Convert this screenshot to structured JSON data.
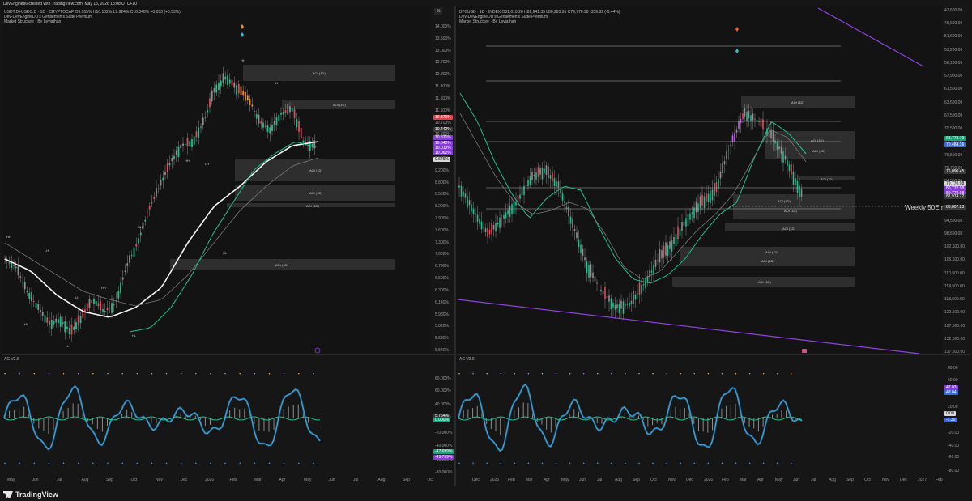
{
  "header": {
    "credit": "DevEngine86 created with TradingView.com, May 15, 2026 18:08 UTC+10"
  },
  "left_chart": {
    "symbol_line": "USDT.D+USDC.D · 1D · CRYPTOCAP  O9.955%  H10.102%  L9.924%  C10.040%  +0.053 (+0.53%)",
    "indicator_1": "Dev-DevEngineDU's Gentlemen's Suite Premium",
    "indicator_2": "Market Structure · By Leviathan",
    "pct_button": "%",
    "price_axis": [
      "14.000%",
      "13.500%",
      "13.000%",
      "12.700%",
      "12.300%",
      "11.900%",
      "11.500%",
      "11.100%",
      "10.700%",
      "10.300%",
      "9.900%",
      "9.500%",
      "9.200%",
      "8.800%",
      "8.500%",
      "8.200%",
      "7.900%",
      "7.600%",
      "7.300%",
      "7.000%",
      "6.790%",
      "6.500%",
      "6.300%",
      "6.140%",
      "5.980%",
      "5.820%",
      "5.680%",
      "5.540%"
    ],
    "badges": [
      {
        "text": "10.870%",
        "color": "#e0404a"
      },
      {
        "text": "10.442%",
        "color": "#3a3a3a"
      },
      {
        "text": "10.371%",
        "color": "#8a3be0"
      },
      {
        "text": "10.040%",
        "color": "#8a3be0"
      },
      {
        "text": "10.013%",
        "color": "#8a3be0"
      },
      {
        "text": "10.062%",
        "color": "#8a3be0"
      },
      {
        "text": "9.645%",
        "color": "#d8d8d8"
      }
    ],
    "time_axis": [
      "May",
      "Jun",
      "Jul",
      "Aug",
      "Sep",
      "Oct",
      "Nov",
      "Dec",
      "2026",
      "Feb",
      "Mar",
      "Apr",
      "May",
      "Jun",
      "Jul",
      "Aug",
      "Sep",
      "Oct"
    ],
    "structure_labels": [
      "HH",
      "LH",
      "HH",
      "LH",
      "HL",
      "LL",
      "HH",
      "HH",
      "LH",
      "HH",
      "LH",
      "HL",
      "HL"
    ],
    "aoi_label": "AOI (1D)",
    "osc_title": "AC V2.6",
    "osc_axis": [
      "80.000%",
      "60.000%",
      "40.000%",
      "20.000%",
      "-20.000%",
      "-40.000%",
      "-60.000%",
      "-80.000%"
    ],
    "osc_badges": [
      {
        "text": "5.764%",
        "color": "#3a3a3a"
      },
      {
        "text": "0.000%",
        "color": "#16a37a"
      },
      {
        "text": "-47.699%",
        "color": "#16a37a"
      },
      {
        "text": "-49.739%",
        "color": "#8a3be0"
      }
    ]
  },
  "right_chart": {
    "symbol_line": "BTCUSD · 1D · INDEX  O81,010.26  H81,641.35  L80,283.95  C79,770.98  -359.89 (-0.44%)",
    "indicator_1": "Dev-DevEngineDU's Gentlemen's Suite Premium",
    "indicator_2": "Market Structure · By Leviathan",
    "price_axis": [
      "47,600.00",
      "49,600.00",
      "51,600.00",
      "53,200.00",
      "56,100.00",
      "57,900.00",
      "61,500.00",
      "63,500.00",
      "67,500.00",
      "70,500.00",
      "73,500.00",
      "76,500.00",
      "79,700.00",
      "84,500.00",
      "87,000.00",
      "90,500.00",
      "94,500.00",
      "98,600.00",
      "102,500.00",
      "106,500.00",
      "110,500.00",
      "114,500.00",
      "118,500.00",
      "122,500.00",
      "127,500.00",
      "132,500.00",
      "137,600.00"
    ],
    "badges": [
      {
        "text": "68,773.79",
        "color": "#16a37a"
      },
      {
        "text": "70,484.16",
        "color": "#3a6ad8"
      },
      {
        "text": "76,090.45",
        "color": "#3a3a3a"
      },
      {
        "text": "79,770.98",
        "color": "#d8d8d8"
      },
      {
        "text": "80,772.98",
        "color": "#8a3be0"
      },
      {
        "text": "80,772.98",
        "color": "#8a3be0"
      },
      {
        "text": "81,974.72",
        "color": "#3a3a3a"
      },
      {
        "text": "85,807.23",
        "color": "#3a3a3a"
      }
    ],
    "weekly_ema": "Weekly 50Ema",
    "time_axis": [
      "Dec",
      "2025",
      "Feb",
      "Mar",
      "Apr",
      "May",
      "Jun",
      "Jul",
      "Aug",
      "Sep",
      "Oct",
      "Nov",
      "Dec",
      "2026",
      "Feb",
      "Mar",
      "Apr",
      "May",
      "Jun",
      "Jul",
      "Aug",
      "Sep",
      "Oct",
      "Nov",
      "Dec",
      "2027",
      "Feb"
    ],
    "osc_title": "AC V2.6",
    "osc_axis": [
      "80.00",
      "60.00",
      "40.00",
      "20.00",
      "-20.00",
      "-40.00",
      "-60.00",
      "-80.00"
    ],
    "osc_badges": [
      {
        "text": "47.03",
        "color": "#8a3be0"
      },
      {
        "text": "43.04",
        "color": "#3a6ad8"
      },
      {
        "text": "0.00",
        "color": "#d8d8d8"
      },
      {
        "text": "-1.30",
        "color": "#3a6ad8"
      }
    ]
  },
  "footer": {
    "logo": "TradingView"
  },
  "colors": {
    "background": "#131313",
    "up_candle": "#1fbf8f",
    "down_candle": "#e04a5a",
    "purple": "#8a3be0",
    "orange": "#f0932a",
    "osc_line": "#4aa8d8"
  }
}
